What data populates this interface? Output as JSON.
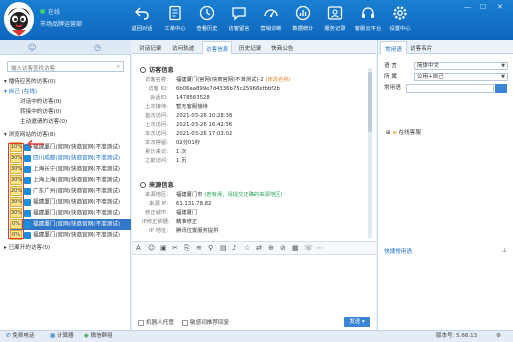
{
  "header": {
    "status": "在线",
    "role": "市场品牌运营部",
    "toolbar": [
      {
        "label": "返回对话",
        "icon": "back-arrow-icon"
      },
      {
        "label": "工单中心",
        "icon": "document-icon"
      },
      {
        "label": "查看历史",
        "icon": "clock-icon"
      },
      {
        "label": "访客留言",
        "icon": "message-icon"
      },
      {
        "label": "营销诊断",
        "icon": "gauge-icon"
      },
      {
        "label": "数据统计",
        "icon": "bar-chart-icon"
      },
      {
        "label": "服务记录",
        "icon": "person-record-icon"
      },
      {
        "label": "客服云平台",
        "icon": "headset-icon"
      },
      {
        "label": "设置中心",
        "icon": "gear-icon"
      }
    ],
    "window_controls": [
      "minimize",
      "maximize",
      "close"
    ]
  },
  "left": {
    "search_placeholder": "输入访客查找访客",
    "groups": [
      {
        "label": "▾ 播待应答的访客(0)"
      },
      {
        "label": "▾ 自己 (在线)"
      },
      {
        "label": "对话中的访客(0)"
      },
      {
        "label": "转接中的访客(0)"
      },
      {
        "label": "主动邀请的访客(0)"
      },
      {
        "label": "▾ 浏览网站的访客(8)"
      }
    ],
    "visitors": [
      {
        "pct": "10%",
        "name": "福建厦门(官网(快商官网(不准测试)",
        "selected": false
      },
      {
        "pct": "30%",
        "name": "四川成都(官网(快商官网(不准测试)",
        "selected": false
      },
      {
        "pct": "30%",
        "name": "上海长宁(官网(快商官网(不准测试)",
        "selected": false
      },
      {
        "pct": "30%",
        "name": "上海上海(官网(快商官网(不准测试)",
        "selected": false
      },
      {
        "pct": "20%",
        "name": "广东广州(官网(快商官网(不准测试)",
        "selected": false
      },
      {
        "pct": "30%",
        "name": "福建厦门(官网(快商官网(不准测试)",
        "selected": false
      },
      {
        "pct": "30%",
        "name": "福建厦门(官网(快商官网(不准测试)",
        "selected": false
      },
      {
        "pct": "0%",
        "name": "福建厦门(官网(快商官网(不准测试)",
        "selected": true
      },
      {
        "pct": "0%",
        "name": "福建厦门(官网(快商官网(不准测试)",
        "selected": false
      }
    ],
    "left_footer_group": "▸ 已离开的访客(0)"
  },
  "center": {
    "tabs": [
      "对话记录",
      "访问轨迹",
      "访客信息",
      "历史记录",
      "快商公告"
    ],
    "active_tab": 2,
    "visitor_section": "访客信息",
    "visitor_fields": [
      {
        "k": "访客名称:",
        "v": "福建厦门(官网(快商官网(不准测试)-2",
        "extra": "(修改名称)",
        "cls": ""
      },
      {
        "k": "访客 ID:",
        "v": "6b06aa899e7d4336b75c25968efbbf2b",
        "cls": ""
      },
      {
        "k": "会话ID:",
        "v": "1478563528",
        "cls": ""
      },
      {
        "k": "上次接待:",
        "v": "暂无客服接待",
        "cls": ""
      },
      {
        "k": "首次访问:",
        "v": "2021-03-26 10:28:38",
        "cls": ""
      },
      {
        "k": "上次访问:",
        "v": "2021-03-26 16:42:36",
        "cls": ""
      },
      {
        "k": "本次访问:",
        "v": "2021-03-26 17:03:02",
        "cls": ""
      },
      {
        "k": "本次停留:",
        "v": "02分01秒",
        "cls": ""
      },
      {
        "k": "累计来访:",
        "v": "1 次",
        "cls": ""
      },
      {
        "k": "之前访问:",
        "v": "1 页",
        "cls": ""
      }
    ],
    "source_section": "来源信息",
    "source_fields": [
      {
        "k": "来源地区:",
        "v": "福建厦门市",
        "extra": "(若有误，请提交正确的来源地区)",
        "cls": "green"
      },
      {
        "k": "来源 IP:",
        "v": "61.131.78.82",
        "cls": ""
      },
      {
        "k": "修正城市:",
        "v": "福建厦门",
        "cls": ""
      },
      {
        "k": "IP修正依据:",
        "v": "精准修正",
        "cls": ""
      },
      {
        "k": "IP 地址:",
        "v": "腾讯位置服务提供",
        "cls": ""
      }
    ],
    "robot_option": "机器人托管",
    "sensitive_option": "敏感词推荐回复",
    "send_label": "发送"
  },
  "right": {
    "tabs": [
      "常用语",
      "访客名片"
    ],
    "active_tab": 0,
    "language_label": "语  言",
    "language_value": "简体中文",
    "belong_label": "所  属",
    "belong_value": "公用+自己",
    "common_label": "常用语",
    "group_label": "在线客服",
    "quick_link": "快捷常用语"
  },
  "statusbar": {
    "items": [
      "免费电话",
      "计算器",
      "微信群组"
    ],
    "version": "版本号: 5.66.13"
  }
}
